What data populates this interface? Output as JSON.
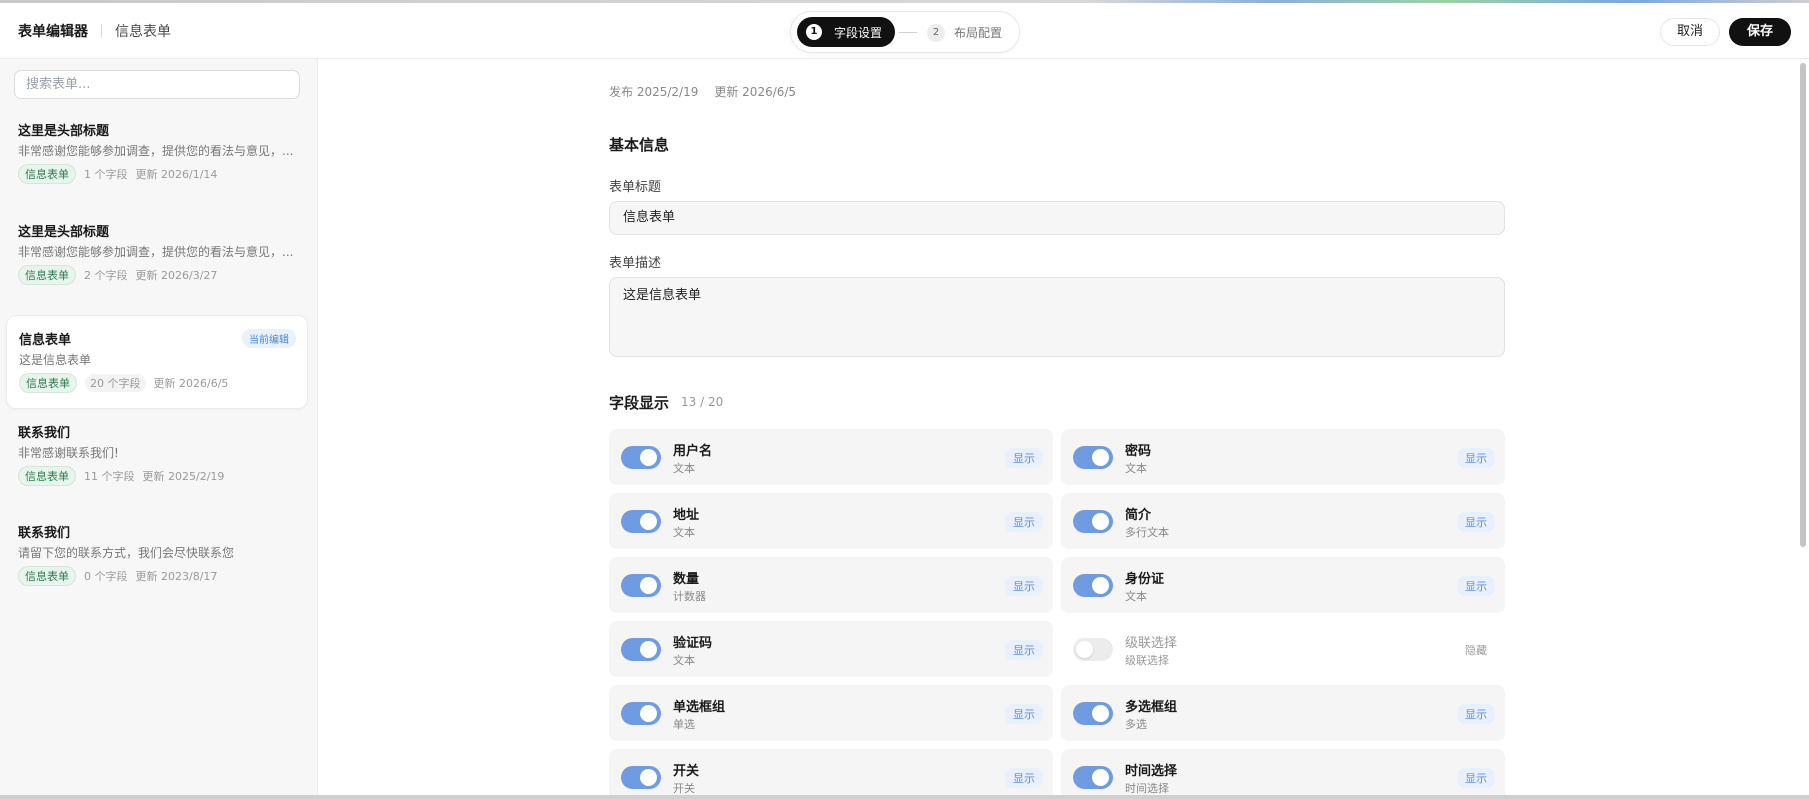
{
  "header": {
    "app_title": "表单编辑器",
    "form_name": "信息表单",
    "steps": [
      {
        "num": "1",
        "label": "字段设置"
      },
      {
        "num": "2",
        "label": "布局配置"
      }
    ],
    "cancel_label": "取消",
    "save_label": "保存"
  },
  "sidebar": {
    "search_placeholder": "搜索表单...",
    "items": [
      {
        "title": "这里是头部标题",
        "desc": "非常感谢您能够参加调查，提供您的看法与意见，...",
        "tag": "信息表单",
        "fields": "1 个字段",
        "updated": "更新 2026/1/14"
      },
      {
        "title": "这里是头部标题",
        "desc": "非常感谢您能够参加调查，提供您的看法与意见，...",
        "tag": "信息表单",
        "fields": "2 个字段",
        "updated": "更新 2026/3/27"
      },
      {
        "title": "信息表单",
        "desc": "这是信息表单",
        "tag": "信息表单",
        "fields": "20 个字段",
        "updated": "更新 2026/6/5",
        "badge": "当前编辑"
      },
      {
        "title": "联系我们",
        "desc": "非常感谢联系我们!",
        "tag": "信息表单",
        "fields": "11 个字段",
        "updated": "更新 2025/2/19"
      },
      {
        "title": "联系我们",
        "desc": "请留下您的联系方式，我们会尽快联系您",
        "tag": "信息表单",
        "fields": "0 个字段",
        "updated": "更新 2023/8/17"
      }
    ]
  },
  "main": {
    "published": "发布 2025/2/19",
    "updated": "更新 2026/6/5",
    "basic_title": "基本信息",
    "form_title_label": "表单标题",
    "form_title_value": "信息表单",
    "form_desc_label": "表单描述",
    "form_desc_value": "这是信息表单",
    "fields_title": "字段显示",
    "fields_count": "13 / 20",
    "fields": [
      {
        "name": "用户名",
        "type": "文本",
        "on": true,
        "state": "显示"
      },
      {
        "name": "密码",
        "type": "文本",
        "on": true,
        "state": "显示"
      },
      {
        "name": "地址",
        "type": "文本",
        "on": true,
        "state": "显示"
      },
      {
        "name": "简介",
        "type": "多行文本",
        "on": true,
        "state": "显示"
      },
      {
        "name": "数量",
        "type": "计数器",
        "on": true,
        "state": "显示"
      },
      {
        "name": "身份证",
        "type": "文本",
        "on": true,
        "state": "显示"
      },
      {
        "name": "验证码",
        "type": "文本",
        "on": true,
        "state": "显示"
      },
      {
        "name": "级联选择",
        "type": "级联选择",
        "on": false,
        "state": "隐藏"
      },
      {
        "name": "单选框组",
        "type": "单选",
        "on": true,
        "state": "显示"
      },
      {
        "name": "多选框组",
        "type": "多选",
        "on": true,
        "state": "显示"
      },
      {
        "name": "开关",
        "type": "开关",
        "on": true,
        "state": "显示"
      },
      {
        "name": "时间选择",
        "type": "时间选择",
        "on": true,
        "state": "显示"
      }
    ]
  }
}
